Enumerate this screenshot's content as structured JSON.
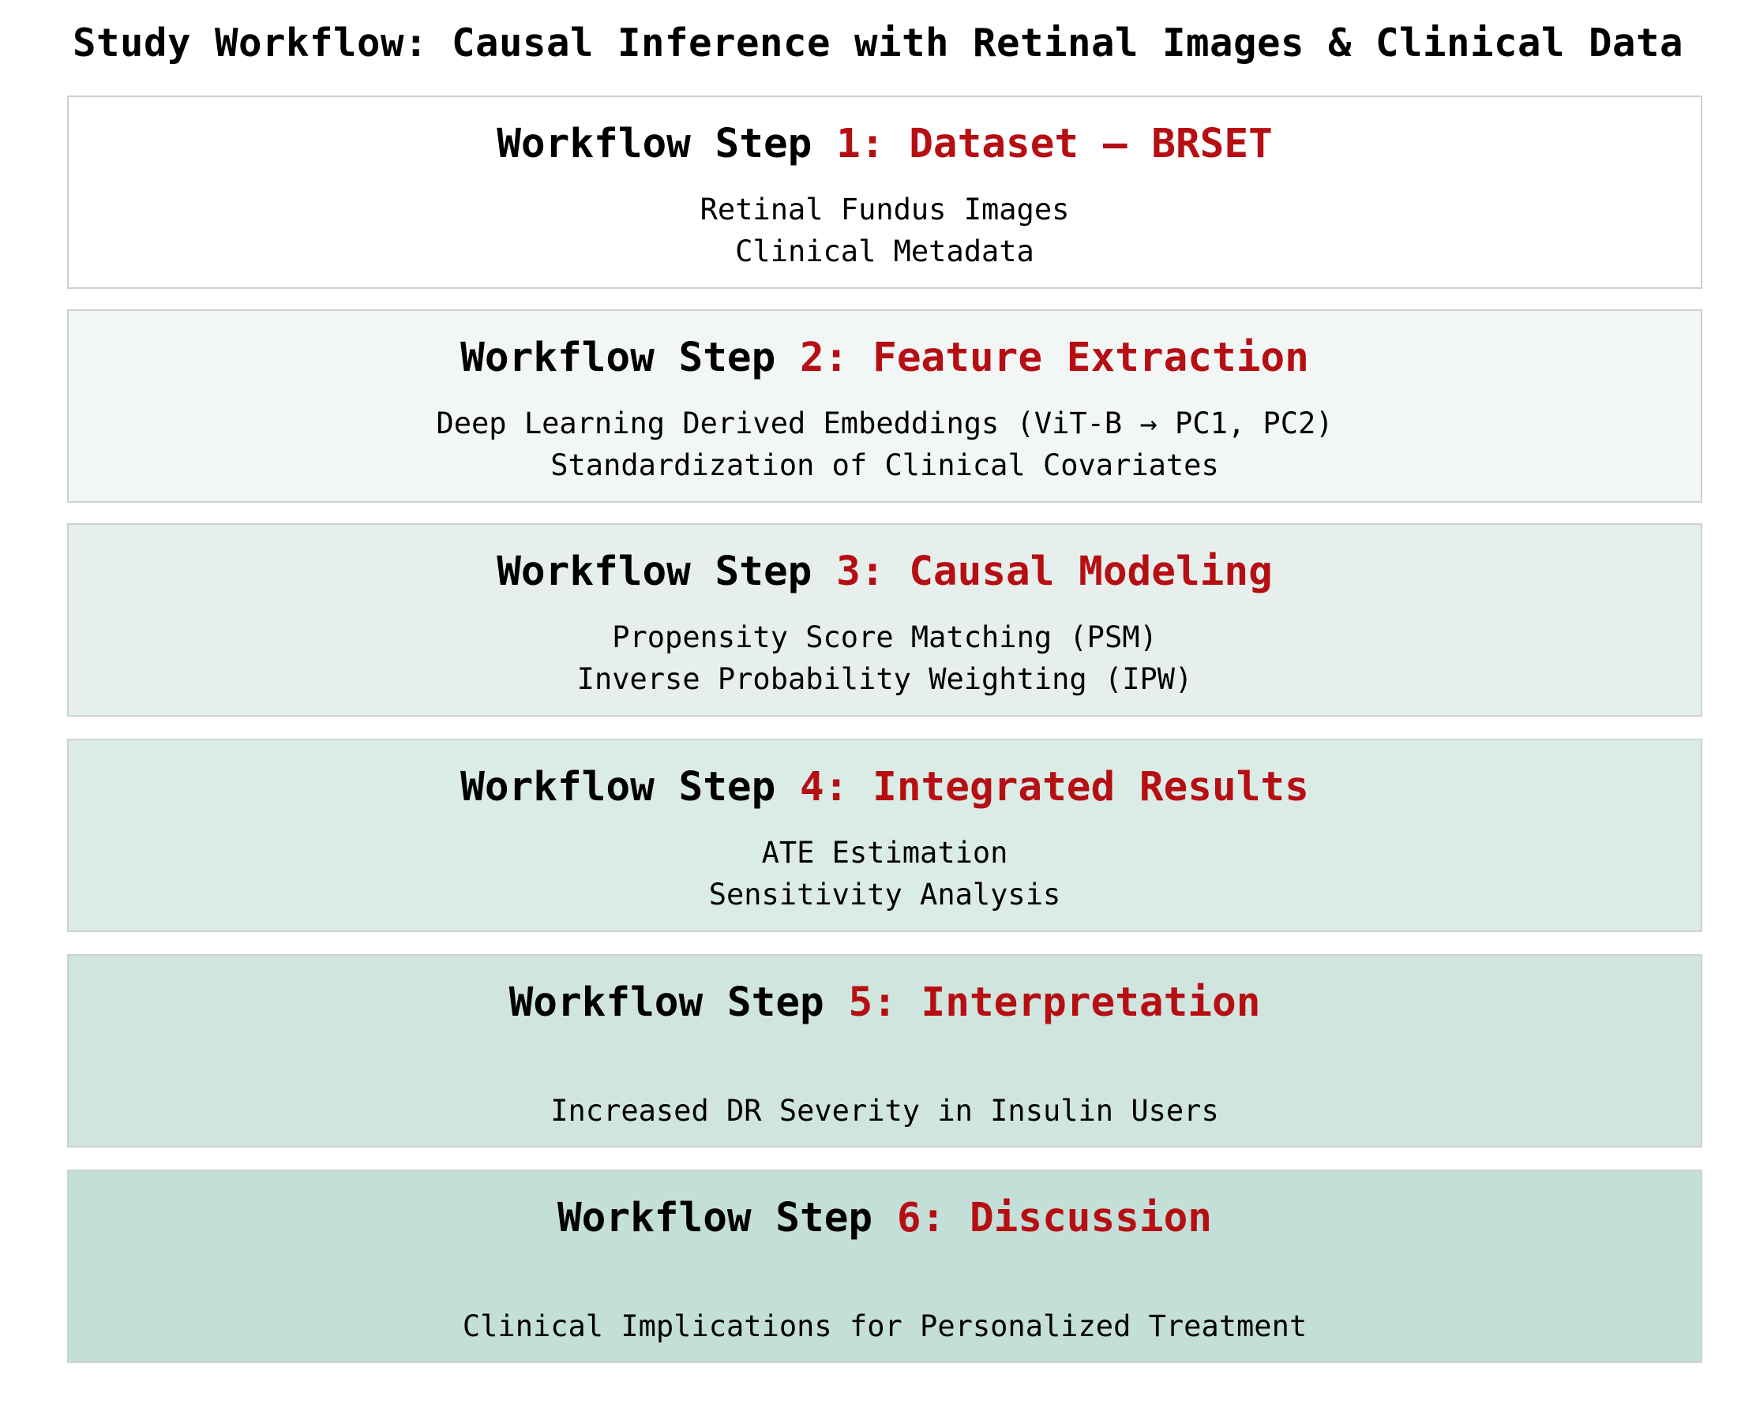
{
  "title": "Study Workflow: Causal Inference with Retinal Images & Clinical Data",
  "colors": {
    "heading_text": "#000000",
    "step_accent": "#b50f14",
    "box_border": "#c9d3d0",
    "box_fills": [
      "#ffffff",
      "#f2f6f5",
      "#e6efec",
      "#dbebe5",
      "#d1e5df",
      "#c4dfd8"
    ]
  },
  "steps": [
    {
      "prefix": "Workflow Step ",
      "accent": "1: Dataset – BRSET",
      "lines": [
        "Retinal Fundus Images",
        "Clinical Metadata"
      ]
    },
    {
      "prefix": "Workflow Step ",
      "accent": "2: Feature Extraction",
      "lines": [
        "Deep Learning Derived Embeddings (ViT-B → PC1, PC2)",
        "Standardization of Clinical Covariates"
      ]
    },
    {
      "prefix": "Workflow Step ",
      "accent": "3: Causal Modeling",
      "lines": [
        "Propensity Score Matching (PSM)",
        "Inverse Probability Weighting (IPW)"
      ]
    },
    {
      "prefix": "Workflow Step ",
      "accent": "4: Integrated Results",
      "lines": [
        "ATE Estimation",
        "Sensitivity Analysis"
      ]
    },
    {
      "prefix": "Workflow Step ",
      "accent": "5: Interpretation",
      "lines": [
        "Increased DR Severity in Insulin Users"
      ]
    },
    {
      "prefix": "Workflow Step ",
      "accent": "6: Discussion",
      "lines": [
        "Clinical Implications for Personalized Treatment"
      ]
    }
  ]
}
